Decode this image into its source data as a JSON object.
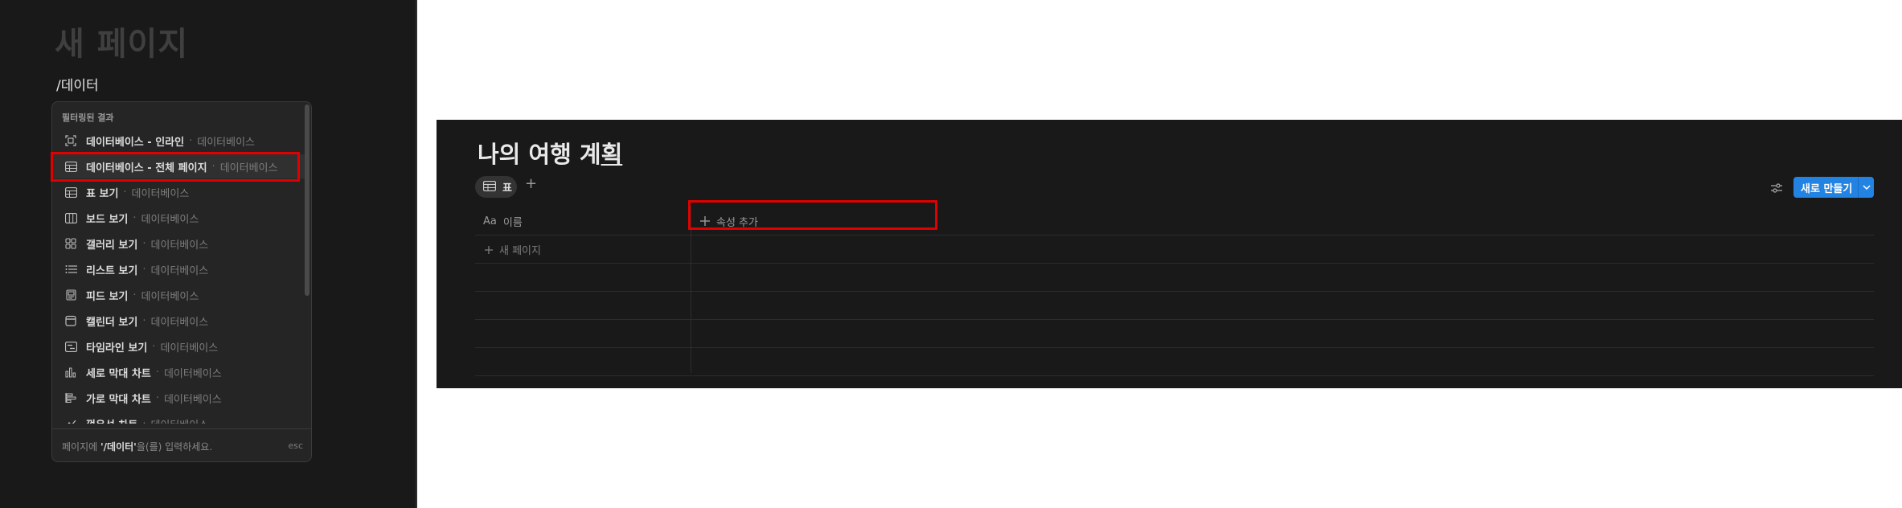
{
  "left_panel": {
    "page_title": "새 페이지",
    "command_text": "/데이터",
    "menu": {
      "header": "필터링된 결과",
      "items": [
        {
          "icon": "inline-database-icon",
          "label": "데이터베이스 - 인라인",
          "sub": "데이터베이스"
        },
        {
          "icon": "table-icon",
          "label": "데이터베이스 - 전체 페이지",
          "sub": "데이터베이스"
        },
        {
          "icon": "table-icon",
          "label": "표 보기",
          "sub": "데이터베이스"
        },
        {
          "icon": "board-icon",
          "label": "보드 보기",
          "sub": "데이터베이스"
        },
        {
          "icon": "gallery-icon",
          "label": "갤러리 보기",
          "sub": "데이터베이스"
        },
        {
          "icon": "list-icon",
          "label": "리스트 보기",
          "sub": "데이터베이스"
        },
        {
          "icon": "feed-icon",
          "label": "피드 보기",
          "sub": "데이터베이스"
        },
        {
          "icon": "calendar-icon",
          "label": "캘린더 보기",
          "sub": "데이터베이스"
        },
        {
          "icon": "timeline-icon",
          "label": "타임라인 보기",
          "sub": "데이터베이스"
        },
        {
          "icon": "vertical-bar-chart-icon",
          "label": "세로 막대 차트",
          "sub": "데이터베이스"
        },
        {
          "icon": "horizontal-bar-chart-icon",
          "label": "가로 막대 차트",
          "sub": "데이터베이스"
        },
        {
          "icon": "line-chart-icon",
          "label": "꺾은선 차트",
          "sub": "데이터베이스"
        }
      ],
      "dot": "·",
      "footer_prefix": "페이지에",
      "footer_command": "'/데이터'",
      "footer_suffix": "을(를) 입력하세요.",
      "esc": "esc"
    }
  },
  "right_panel": {
    "db_title_main": "나의 여행 계",
    "db_title_caret": "획",
    "view_tab": {
      "icon": "table-icon",
      "label": "표"
    },
    "add_view": "+",
    "new_button": {
      "label": "새로 만들기"
    },
    "columns": {
      "name_icon": "Aa",
      "name": "이름",
      "add_property": "속성 추가"
    },
    "new_page": "새 페이지"
  },
  "colors": {
    "accent": "#2383e2",
    "highlight": "#e00000",
    "background": "#191919"
  }
}
